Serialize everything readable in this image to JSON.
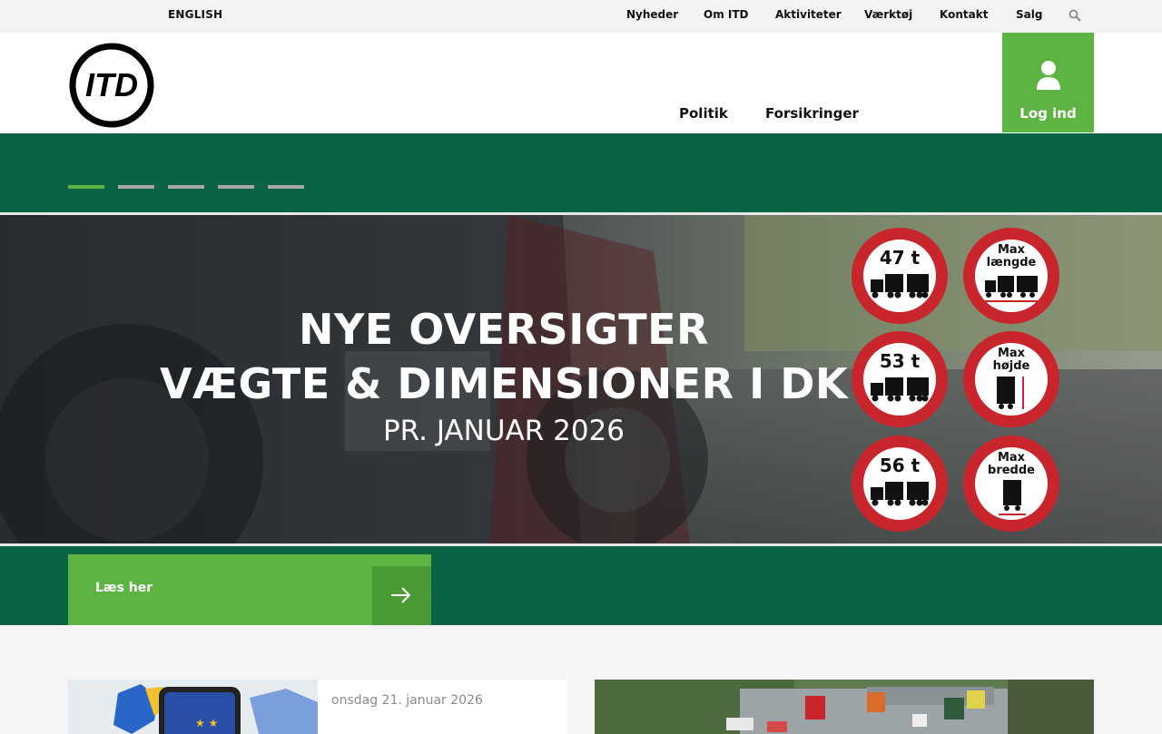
{
  "topbar": {
    "language": "ENGLISH",
    "links": [
      "Nyheder",
      "Om ITD",
      "Aktiviteter",
      "Værktøj",
      "Kontakt",
      "Salg"
    ]
  },
  "header": {
    "logo_text": "ITD",
    "nav": [
      "Politik",
      "Forsikringer"
    ],
    "login_label": "Log ind"
  },
  "slider": {
    "dots_count": 5,
    "active_index": 0
  },
  "banner": {
    "title_line1": "NYE OVERSIGTER",
    "title_line2": "VÆGTE & DIMENSIONER I DK",
    "title_line3": "PR. JANUAR  2026",
    "signs": [
      {
        "label": "47 t"
      },
      {
        "label": "Max længde"
      },
      {
        "label": "53 t"
      },
      {
        "label": "Max højde"
      },
      {
        "label": "56 t"
      },
      {
        "label": "Max bredde"
      }
    ]
  },
  "cta": {
    "label": "Læs her"
  },
  "news": [
    {
      "date": "onsdag 21. januar 2026"
    }
  ],
  "colors": {
    "brand_green": "#0a6444",
    "accent_green": "#5db443",
    "sign_red": "#c9252c"
  }
}
